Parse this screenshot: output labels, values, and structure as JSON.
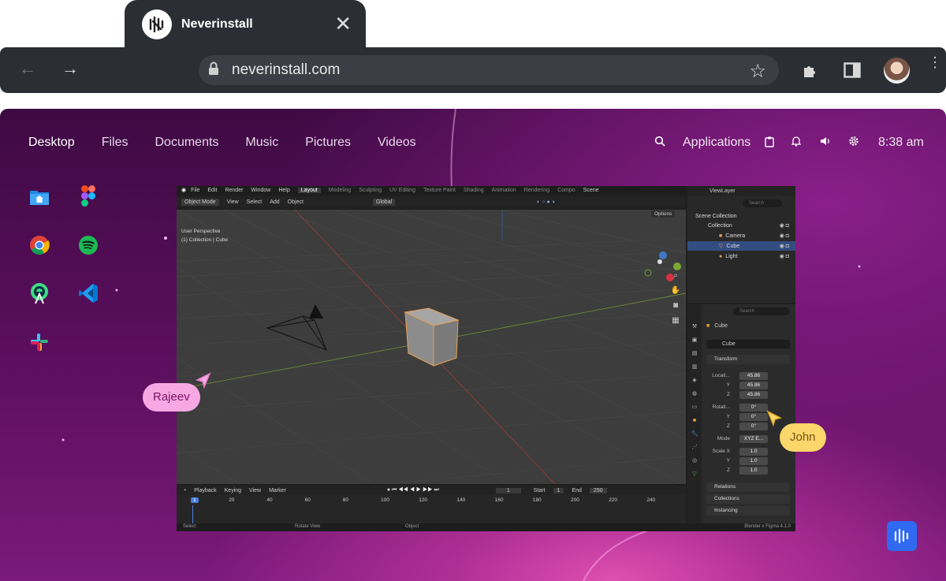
{
  "browser": {
    "tab_title": "Neverinstall",
    "url": "neverinstall.com",
    "close_glyph": "✕"
  },
  "desktop": {
    "nav": [
      "Desktop",
      "Files",
      "Documents",
      "Music",
      "Pictures",
      "Videos"
    ],
    "applications_label": "Applications",
    "clock": "8:38 am",
    "icons": [
      "home-folder-icon",
      "figma-icon",
      "chrome-icon",
      "spotify-icon",
      "android-studio-icon",
      "vscode-icon",
      "slack-icon"
    ]
  },
  "blender": {
    "menu": [
      "File",
      "Edit",
      "Render",
      "Window",
      "Help"
    ],
    "workspaces": [
      "Layout",
      "Modeling",
      "Sculpting",
      "UV Editing",
      "Texture Paint",
      "Shading",
      "Animation",
      "Rendering",
      "Compo"
    ],
    "scene": "Scene",
    "view_layer": "ViewLayer",
    "header": {
      "mode": "Object Mode",
      "menus": [
        "View",
        "Select",
        "Add",
        "Object"
      ],
      "orientation": "Global",
      "options": "Options"
    },
    "viewport": {
      "perspective": "User Perspective",
      "context": "(1) Collection | Cube"
    },
    "outliner": {
      "search_placeholder": "Search",
      "items": [
        "Scene Collection",
        "Collection",
        "Camera",
        "Cube",
        "Light"
      ]
    },
    "properties": {
      "search_placeholder": "Search",
      "object_name": "Cube",
      "mesh_name": "Cube",
      "transform_label": "Transform",
      "location_label": "Locati...",
      "location": [
        "45.86",
        "45.86",
        "45.86"
      ],
      "rotation_label": "Rotati...",
      "rotation": [
        "0°",
        "0°",
        "0°"
      ],
      "mode_label": "Mode",
      "mode_value": "XYZ E...",
      "scale_label": "Scale X",
      "scale": [
        "1.0",
        "1.0",
        "1.0"
      ],
      "axes": [
        "Y",
        "Z"
      ],
      "sections": [
        "Relations",
        "Collections",
        "Instancing"
      ]
    },
    "timeline": {
      "menus": [
        "Playback",
        "Keying",
        "View",
        "Marker"
      ],
      "current_frame": "1",
      "start_label": "Start",
      "start": "1",
      "end_label": "End",
      "end": "250",
      "ticks": [
        "1",
        "20",
        "40",
        "60",
        "80",
        "100",
        "120",
        "140",
        "160",
        "180",
        "200",
        "220",
        "240"
      ]
    },
    "status": {
      "select": "Select",
      "rotate": "Rotate View",
      "object": "Object",
      "version": "Blender x Figma 4.1.0"
    }
  },
  "collaborators": [
    {
      "name": "Rajeev",
      "color": "#f7a8e3"
    },
    {
      "name": "John",
      "color": "#fbd66a"
    }
  ]
}
